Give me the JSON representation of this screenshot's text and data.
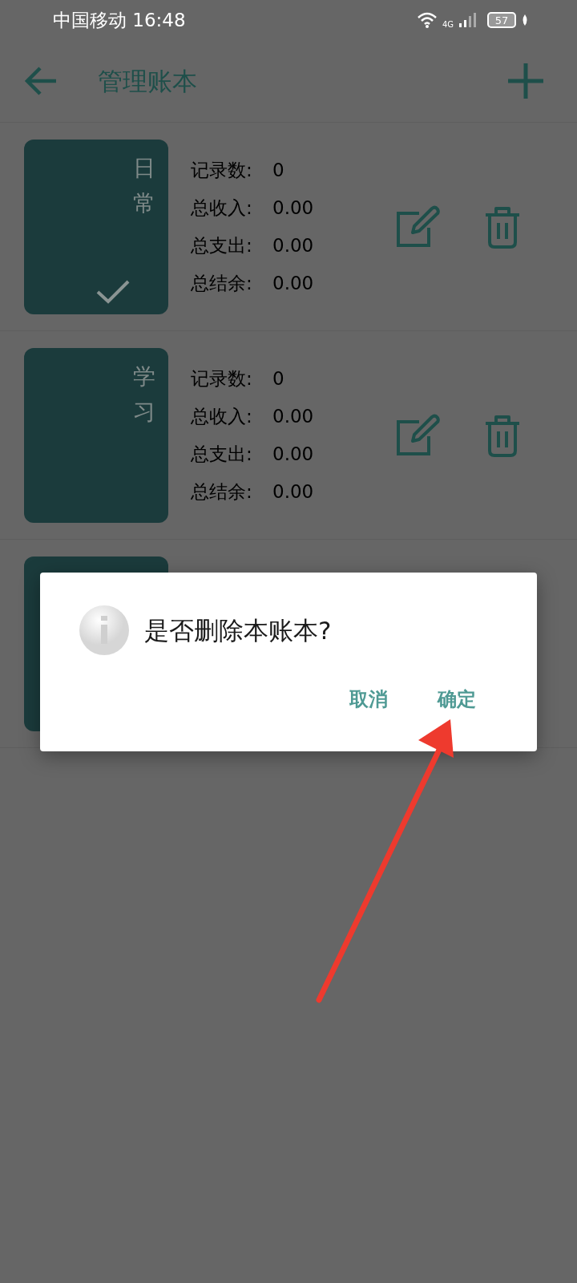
{
  "status_bar": {
    "carrier_time": "中国移动 16:48",
    "network": "4G",
    "battery": "57"
  },
  "app_bar": {
    "title": "管理账本"
  },
  "books": [
    {
      "kind": "full",
      "name": "日常",
      "selected": true,
      "stats": [
        {
          "label": "记录数:",
          "value": "0"
        },
        {
          "label": "总收入:",
          "value": "0.00"
        },
        {
          "label": "总支出:",
          "value": "0.00"
        },
        {
          "label": "总结余:",
          "value": "0.00"
        }
      ]
    },
    {
      "kind": "full",
      "name": "学习",
      "selected": false,
      "stats": [
        {
          "label": "记录数:",
          "value": "0"
        },
        {
          "label": "总收入:",
          "value": "0.00"
        },
        {
          "label": "总支出:",
          "value": "0.00"
        },
        {
          "label": "总结余:",
          "value": "0.00"
        }
      ]
    },
    {
      "kind": "covered"
    }
  ],
  "dialog": {
    "message": "是否删除本账本?",
    "buttons": [
      "取消",
      "确定"
    ]
  }
}
